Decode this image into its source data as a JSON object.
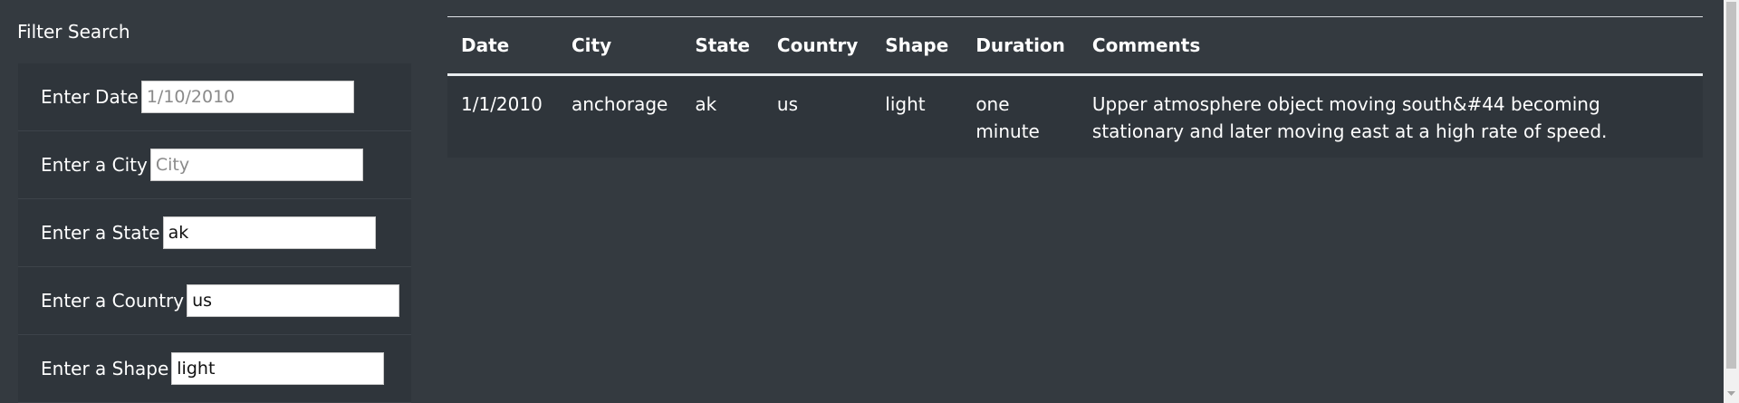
{
  "filter": {
    "title": "Filter Search",
    "fields": [
      {
        "label": "Enter Date",
        "value": "",
        "placeholder": "1/10/2010"
      },
      {
        "label": "Enter a City",
        "value": "",
        "placeholder": "City"
      },
      {
        "label": "Enter a State",
        "value": "ak",
        "placeholder": ""
      },
      {
        "label": "Enter a Country",
        "value": "us",
        "placeholder": ""
      },
      {
        "label": "Enter a Shape",
        "value": "light",
        "placeholder": ""
      }
    ]
  },
  "table": {
    "headers": [
      "Date",
      "City",
      "State",
      "Country",
      "Shape",
      "Duration",
      "Comments"
    ],
    "rows": [
      {
        "date": "1/1/2010",
        "city": "anchorage",
        "state": "ak",
        "country": "us",
        "shape": "light",
        "duration": "one minute",
        "comments": "Upper atmosphere object moving south&#44 becoming stationary and later moving east at a high rate of speed."
      }
    ]
  },
  "colors": {
    "background": "#343a40",
    "sidebar": "#2f353b",
    "text": "#ffffff"
  }
}
